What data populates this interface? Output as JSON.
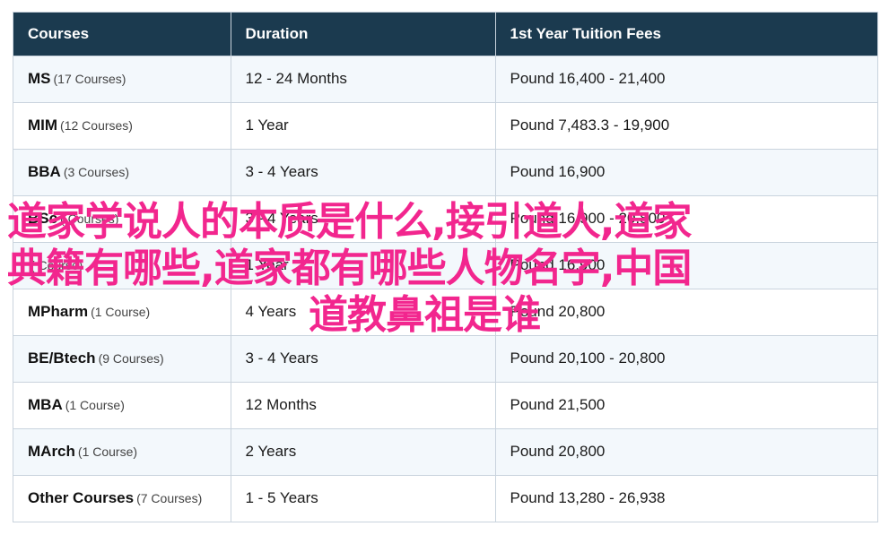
{
  "table": {
    "headers": [
      "Courses",
      "Duration",
      "1st Year Tuition Fees"
    ],
    "rows": [
      {
        "course": "MS",
        "count": "(17 Courses)",
        "duration": "12 - 24 Months",
        "fees": "Pound 16,400 - 21,400"
      },
      {
        "course": "MIM",
        "count": "(12 Courses)",
        "duration": "1 Year",
        "fees": "Pound 7,483.3 - 19,900"
      },
      {
        "course": "BBA",
        "count": "(3 Courses)",
        "duration": "3 - 4 Years",
        "fees": "Pound 16,900"
      },
      {
        "course": "BSc",
        "count": "(  Courses)",
        "duration": "3 - 4 Years",
        "fees": "Pound 16,900 - 20,800"
      },
      {
        "course": "",
        "count": "(  Course)",
        "duration": "1 Year",
        "fees": "Pound 16,900"
      },
      {
        "course": "MPharm",
        "count": "(1 Course)",
        "duration": "4 Years",
        "fees": "Pound 20,800"
      },
      {
        "course": "BE/Btech",
        "count": "(9 Courses)",
        "duration": "3 - 4 Years",
        "fees": "Pound 20,100 - 20,800"
      },
      {
        "course": "MBA",
        "count": "(1 Course)",
        "duration": "12 Months",
        "fees": "Pound 21,500"
      },
      {
        "course": "MArch",
        "count": "(1 Course)",
        "duration": "2 Years",
        "fees": "Pound 20,800"
      },
      {
        "course": "Other Courses",
        "count": "(7 Courses)",
        "duration": "1 - 5 Years",
        "fees": "Pound 13,280 - 26,938"
      }
    ]
  },
  "overlay": {
    "line1": "道家学说人的本质是什么,接引道人,道家",
    "line2": "典籍有哪些,道家都有哪些人物名字,中国",
    "line3": "道教鼻祖是谁"
  },
  "colors": {
    "header_bg": "#1b3a4f",
    "header_text": "#ffffff",
    "row_alt_bg": "#f3f8fc",
    "border": "#c9d3dd",
    "overlay_text": "#f2268e"
  }
}
